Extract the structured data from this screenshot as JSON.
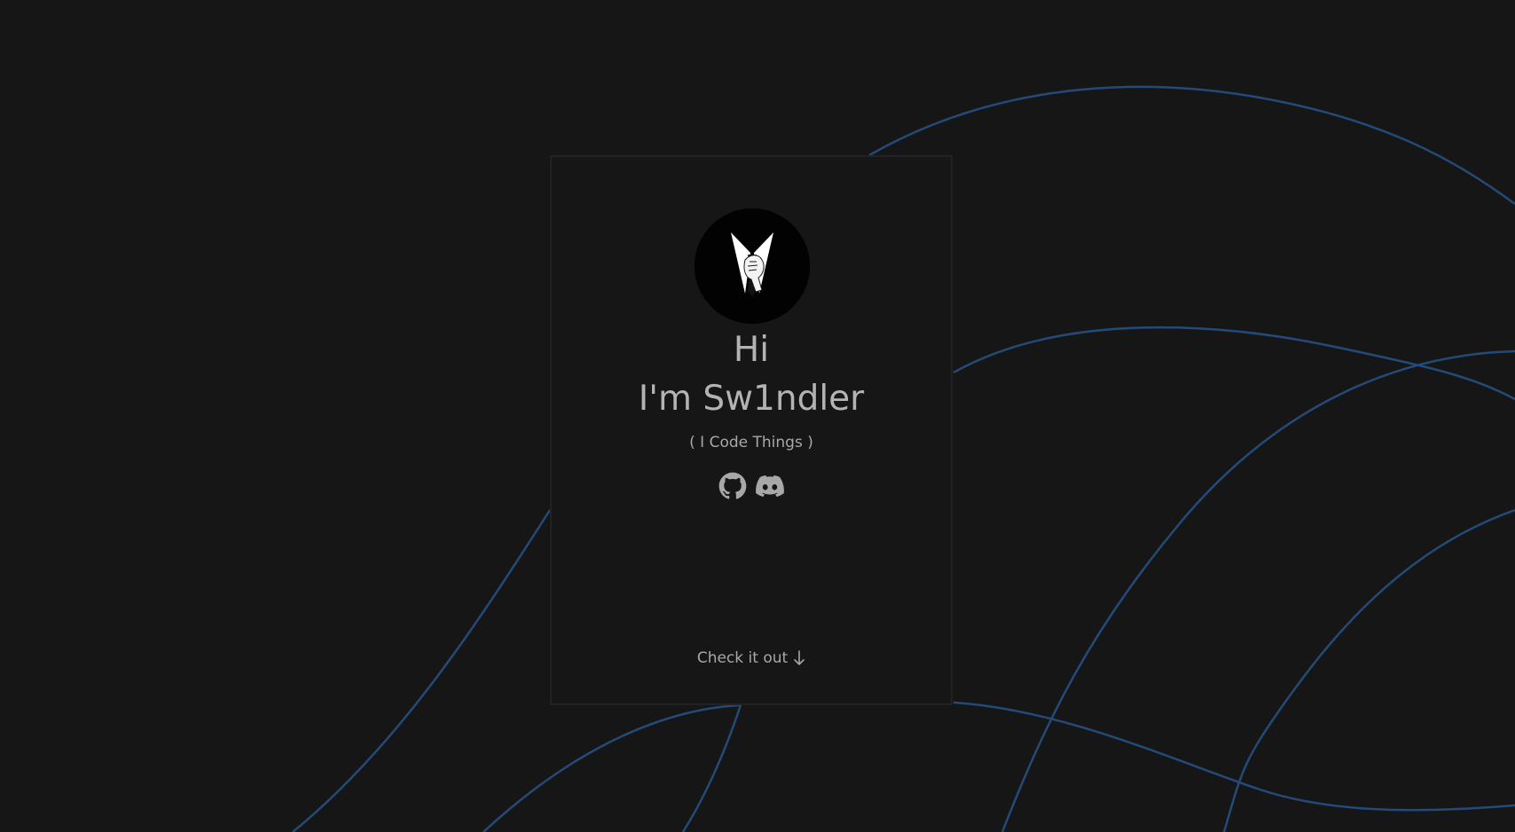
{
  "hero": {
    "greeting": "Hi",
    "name": "I'm Sw1ndler",
    "tagline": "( I Code Things )",
    "cta_label": "Check it out"
  },
  "socials": [
    {
      "icon": "github-icon",
      "label": "GitHub"
    },
    {
      "icon": "discord-icon",
      "label": "Discord"
    }
  ],
  "colors": {
    "background": "#161617",
    "card_border": "#222224",
    "text": "#b3b3b3",
    "accent_lines": "#244a78"
  }
}
